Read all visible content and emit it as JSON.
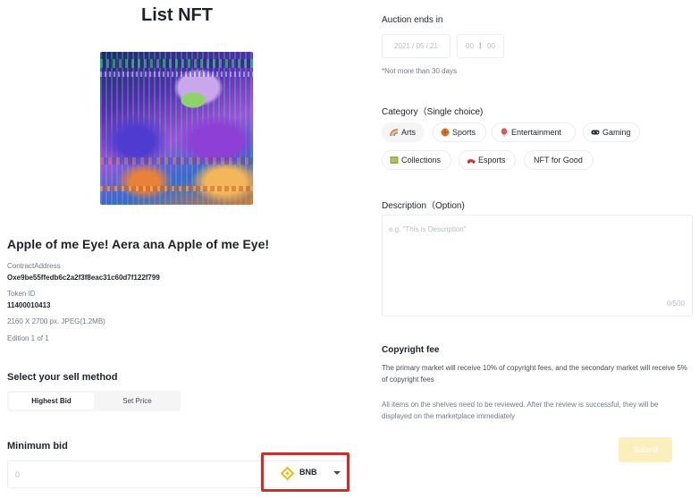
{
  "page": {
    "title": "List NFT"
  },
  "nft": {
    "name": "Apple of me Eye! Aera ana Apple of me Eye!",
    "contract_label": "ContractAddress",
    "contract_value": "Oxe9be55ffedb6c2a2f3f8eac31c60d7f122f799",
    "token_label": "Token ID",
    "token_value": "11400010413",
    "file_info": "2160 X 2700 px. JPEG(1.2MB)",
    "edition": "Edition 1 of 1"
  },
  "sell": {
    "title": "Select your sell method",
    "tabs": [
      {
        "label": "Highest Bid",
        "active": true
      },
      {
        "label": "Set Price",
        "active": false
      }
    ]
  },
  "bid": {
    "title": "Minimum bid",
    "placeholder": "0",
    "currency": "BNB",
    "currency_color": "#f0b90b"
  },
  "auction": {
    "label": "Auction ends in",
    "date": "2021 / 05 / 21",
    "hour": "00",
    "minute": "00",
    "hint": "*Not more than 30 days"
  },
  "category": {
    "label": "Category（Single choice)",
    "chips": [
      {
        "label": "Arts",
        "icon": "rainbow-icon",
        "selected": true
      },
      {
        "label": "Sports",
        "icon": "basketball-icon",
        "selected": false
      },
      {
        "label": "Entertainment",
        "icon": "balloon-icon",
        "selected": false
      },
      {
        "label": "Gaming",
        "icon": "gamepad-icon",
        "selected": false
      },
      {
        "label": "Collections",
        "icon": "frame-icon",
        "selected": false
      },
      {
        "label": "Esports",
        "icon": "racecar-icon",
        "selected": false
      },
      {
        "label": "NFT for Good",
        "icon": "",
        "selected": false
      }
    ]
  },
  "description": {
    "label": "Description（Option)",
    "placeholder": "e.g. \"This is Description\"",
    "counter": "0/500"
  },
  "copyright": {
    "title": "Copyright fee",
    "text": "The primary market will receive 10% of copyright fees, and the secondary market will receive 5% of copyright fees"
  },
  "review_notice": "All items on the shelves need to be reviewed. After the review is successful, they will be displayed on the marketplace immediately",
  "submit": {
    "label": "Submit"
  },
  "colors": {
    "accent": "#f0b90b",
    "submit_disabled": "#fcefbe",
    "highlight_box": "#c9302c"
  }
}
